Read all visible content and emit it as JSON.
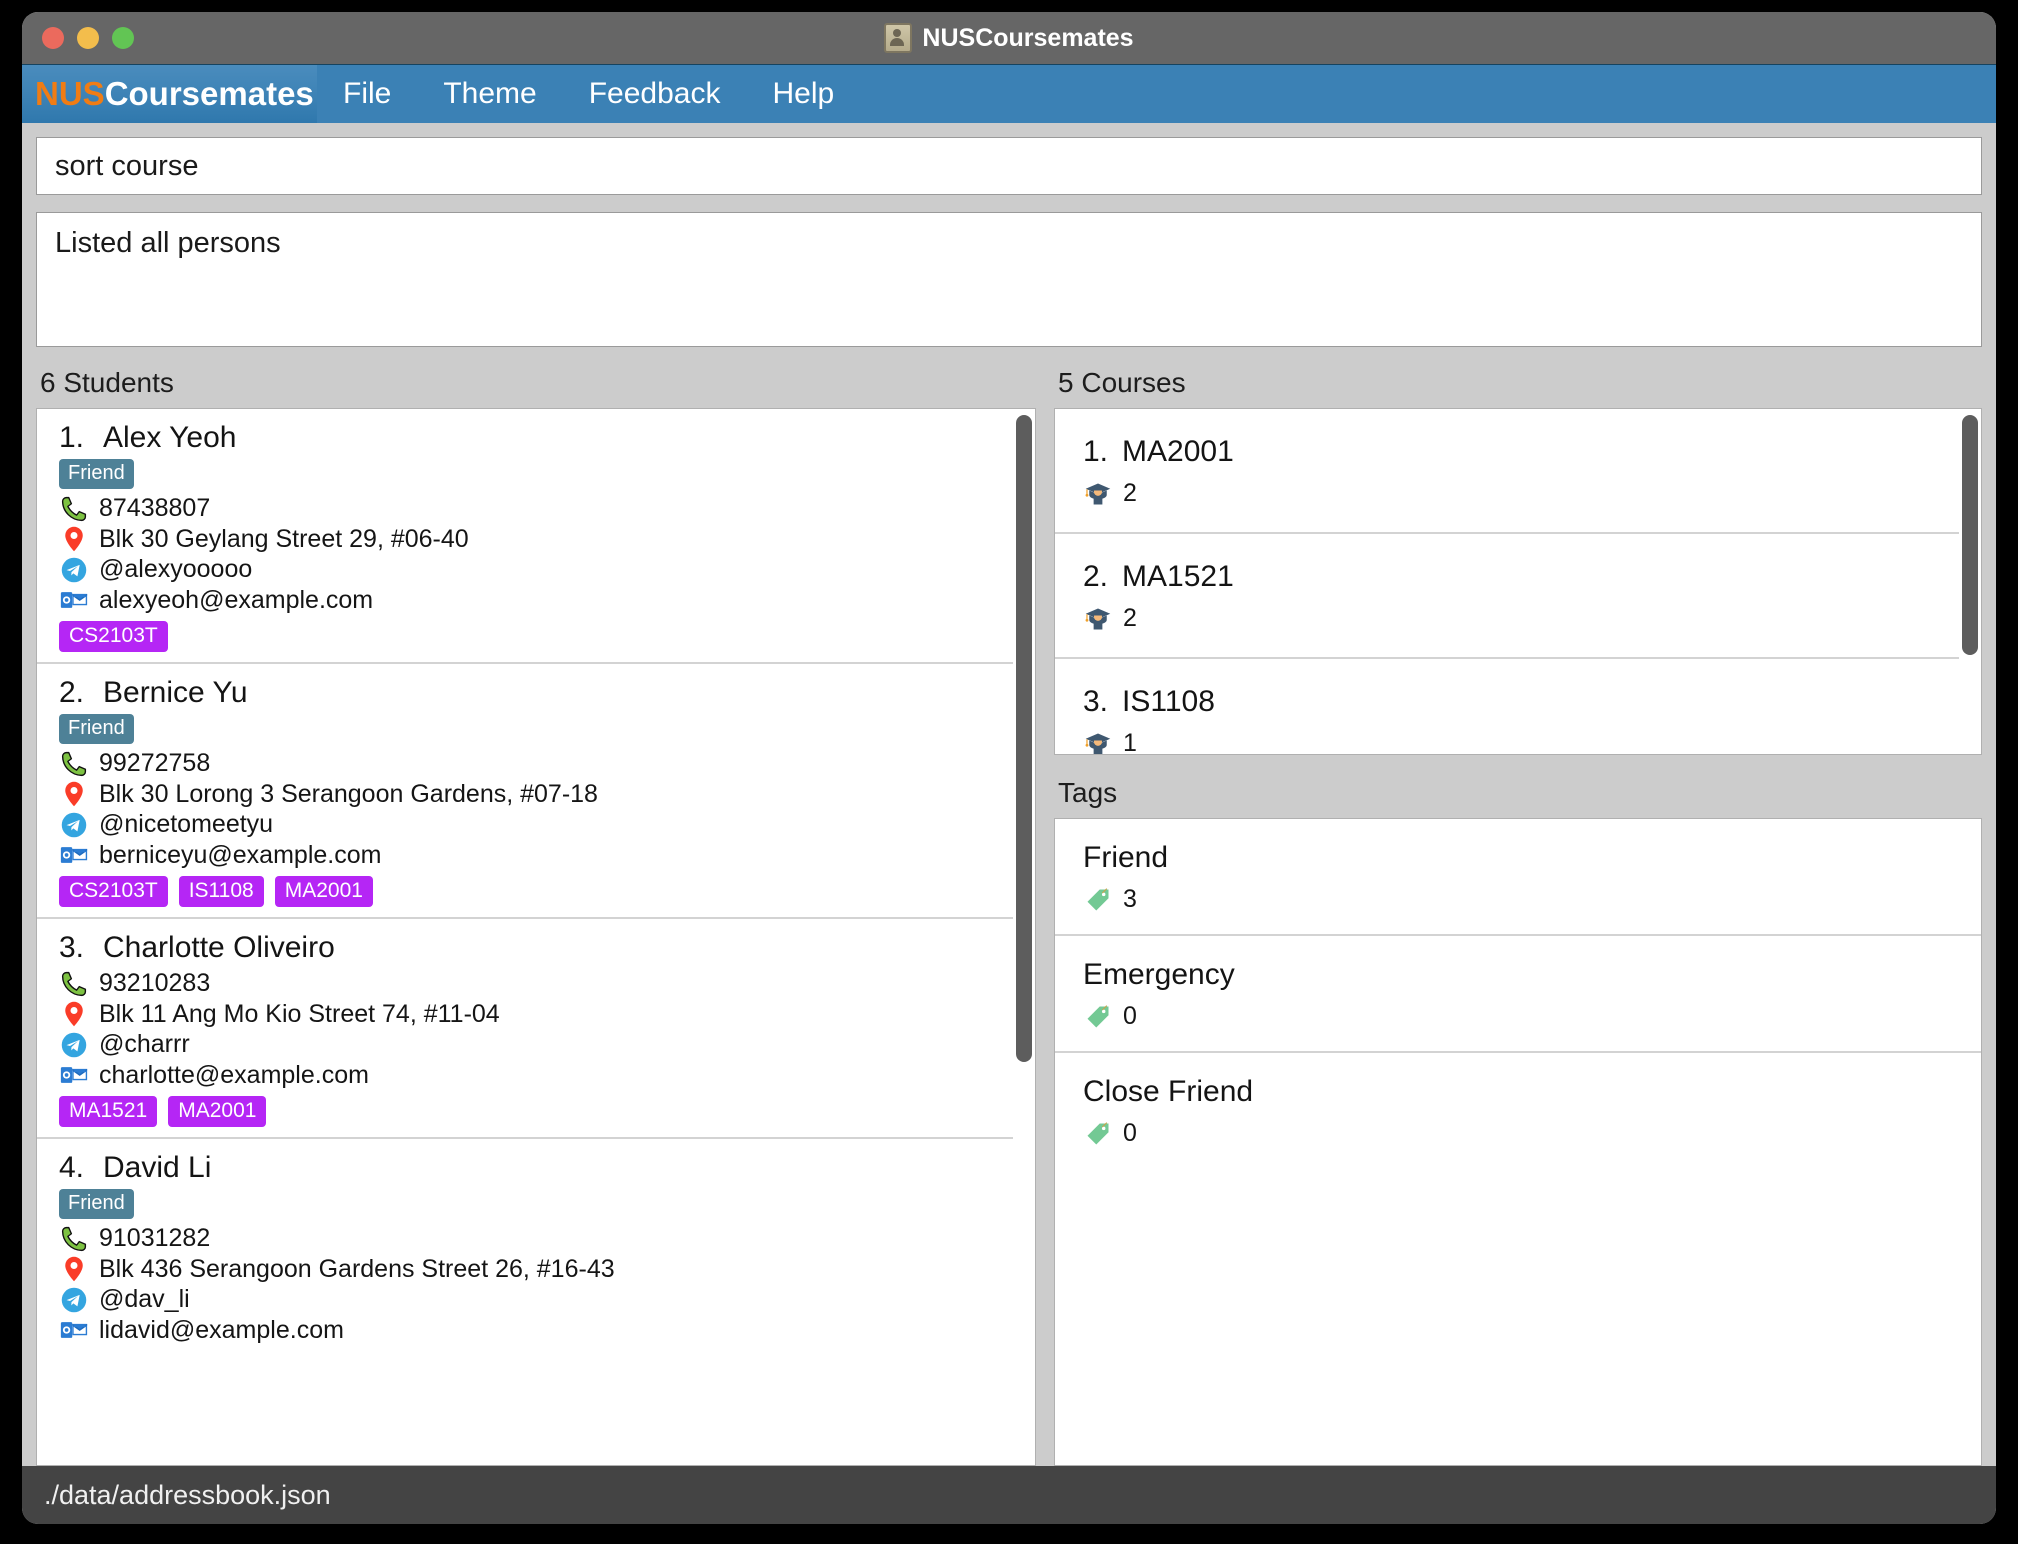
{
  "window": {
    "title": "NUSCoursemates",
    "title_icon": "address-book-icon"
  },
  "menubar": {
    "brand_prefix": "NUS",
    "brand_suffix": "Coursemates",
    "items": [
      {
        "label": "File"
      },
      {
        "label": "Theme"
      },
      {
        "label": "Feedback"
      },
      {
        "label": "Help"
      }
    ]
  },
  "command": {
    "value": "sort course",
    "placeholder": "Enter command here..."
  },
  "result": {
    "text": "Listed all persons"
  },
  "students_panel": {
    "header": "6 Students",
    "persons": [
      {
        "index": "1.",
        "name": "Alex Yeoh",
        "tag": "Friend",
        "phone": "87438807",
        "address": "Blk 30 Geylang Street 29, #06-40",
        "telegram": "@alexyooooo",
        "email": "alexyeoh@example.com",
        "courses": [
          "CS2103T"
        ]
      },
      {
        "index": "2.",
        "name": "Bernice Yu",
        "tag": "Friend",
        "phone": "99272758",
        "address": "Blk 30 Lorong 3 Serangoon Gardens, #07-18",
        "telegram": "@nicetomeetyu",
        "email": "berniceyu@example.com",
        "courses": [
          "CS2103T",
          "IS1108",
          "MA2001"
        ]
      },
      {
        "index": "3.",
        "name": "Charlotte Oliveiro",
        "tag": "",
        "phone": "93210283",
        "address": "Blk 11 Ang Mo Kio Street 74, #11-04",
        "telegram": "@charrr",
        "email": "charlotte@example.com",
        "courses": [
          "MA1521",
          "MA2001"
        ]
      },
      {
        "index": "4.",
        "name": "David Li",
        "tag": "Friend",
        "phone": "91031282",
        "address": "Blk 436 Serangoon Gardens Street 26, #16-43",
        "telegram": "@dav_li",
        "email": "lidavid@example.com",
        "courses": []
      }
    ]
  },
  "courses_panel": {
    "header": "5 Courses",
    "courses": [
      {
        "index": "1.",
        "code": "MA2001",
        "count": "2"
      },
      {
        "index": "2.",
        "code": "MA1521",
        "count": "2"
      },
      {
        "index": "3.",
        "code": "IS1108",
        "count": "1"
      }
    ]
  },
  "tags_panel": {
    "header": "Tags",
    "tags": [
      {
        "name": "Friend",
        "count": "3"
      },
      {
        "name": "Emergency",
        "count": "0"
      },
      {
        "name": "Close Friend",
        "count": "0"
      }
    ]
  },
  "statusbar": {
    "path": "./data/addressbook.json"
  },
  "colors": {
    "accent_blue": "#3b81b5",
    "brand_orange": "#f07c14",
    "tag_badge": "#4e8197",
    "course_chip": "#b526f5",
    "titlebar": "#666666",
    "statusbar": "#444444"
  },
  "icons": {
    "phone": "phone-icon",
    "location": "location-pin-icon",
    "telegram": "telegram-icon",
    "email": "email-icon",
    "graduate": "graduate-icon",
    "tag": "tag-icon"
  }
}
